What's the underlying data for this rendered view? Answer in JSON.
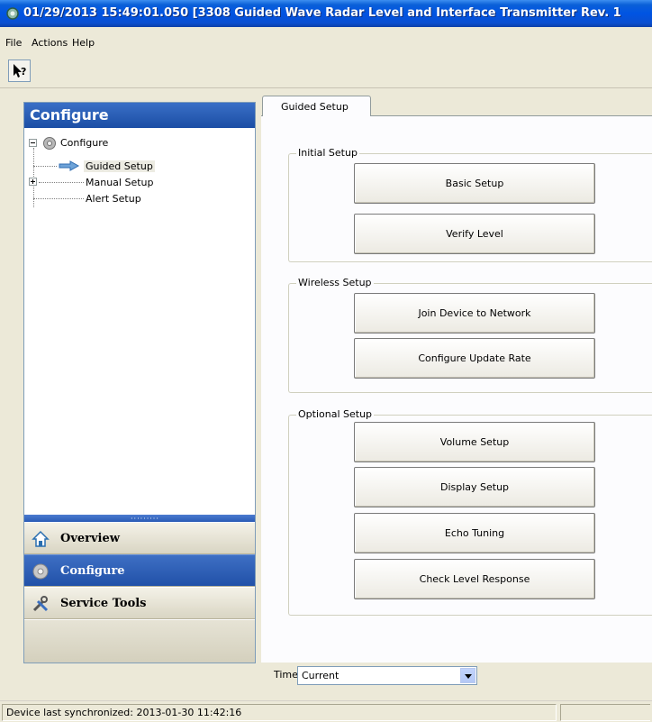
{
  "window": {
    "title": "01/29/2013 15:49:01.050 [3308 Guided Wave Radar Level and Interface Transmitter Rev. 1"
  },
  "menu": [
    "File",
    "Actions",
    "Help"
  ],
  "toolbar": {
    "help_icon": "whats-this-help-icon"
  },
  "left_panel": {
    "header": "Configure",
    "tree": {
      "root": "Configure",
      "children": [
        "Guided Setup",
        "Manual Setup",
        "Alert Setup"
      ],
      "selected": "Guided Setup"
    },
    "nav": [
      {
        "label": "Overview",
        "icon": "home-icon"
      },
      {
        "label": "Configure",
        "icon": "gear-icon"
      },
      {
        "label": "Service Tools",
        "icon": "tools-icon"
      }
    ],
    "active_nav": "Configure"
  },
  "tabs": [
    "Guided Setup"
  ],
  "groups": {
    "initial": {
      "legend": "Initial Setup",
      "buttons": [
        "Basic Setup",
        "Verify Level"
      ]
    },
    "wireless": {
      "legend": "Wireless Setup",
      "buttons": [
        "Join Device to Network",
        "Configure Update Rate"
      ]
    },
    "optional": {
      "legend": "Optional Setup",
      "buttons": [
        "Volume Setup",
        "Display Setup",
        "Echo Tuning",
        "Check Level Response"
      ]
    }
  },
  "time": {
    "label": "Time:",
    "value": "Current"
  },
  "status": {
    "text": "Device last synchronized: 2013-01-30 11:42:16"
  },
  "colors": {
    "title_bar": "#0054e3",
    "active_nav": "#2151a8",
    "panel_header": "#1b4ea5"
  }
}
